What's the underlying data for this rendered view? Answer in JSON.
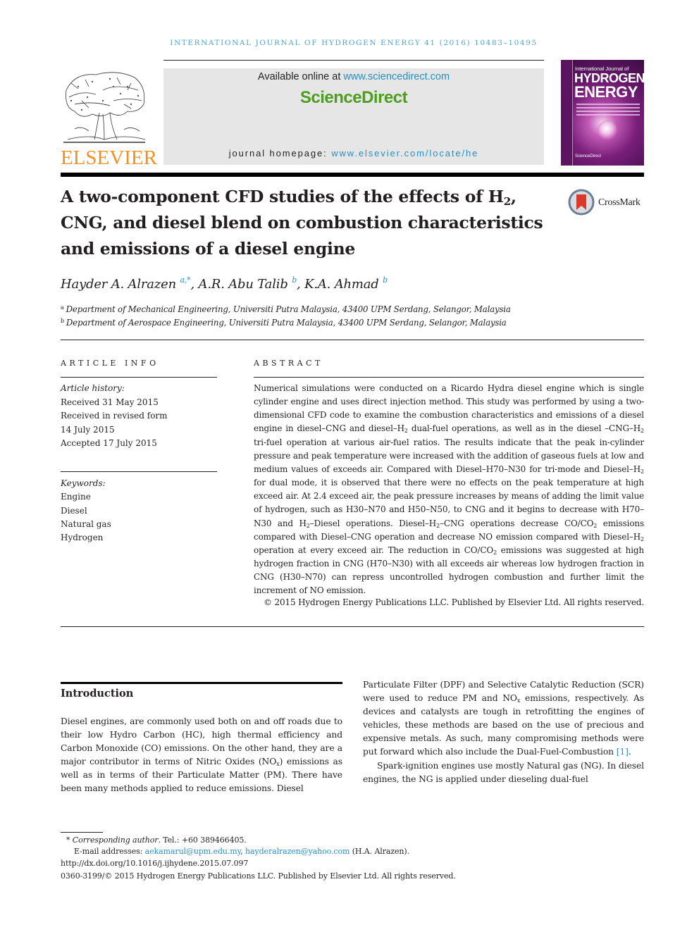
{
  "running_header": "INTERNATIONAL JOURNAL OF HYDROGEN ENERGY 41 (2016) 10483–10495",
  "banner": {
    "publisher_logo": "ELSEVIER",
    "available_online_prefix": "Available online at ",
    "available_online_link": "www.sciencedirect.com",
    "platform_name": "ScienceDirect",
    "homepage_prefix": "journal homepage: ",
    "homepage_link": "www.elsevier.com/locate/he",
    "cover": {
      "line1": "International Journal of",
      "line2": "HYDROGEN",
      "line3": "ENERGY",
      "footer": "ScienceDirect"
    }
  },
  "article": {
    "title_part1": "A two-component CFD studies of the effects of H",
    "title_sub": "2",
    "title_part2": ", CNG, and diesel blend on combustion characteristics and emissions of a diesel engine",
    "crossmark_label": "CrossMark",
    "authors": [
      {
        "name": "Hayder A. Alrazen",
        "marks": "a,*"
      },
      {
        "name": "A.R. Abu Talib",
        "marks": "b"
      },
      {
        "name": "K.A. Ahmad",
        "marks": "b"
      }
    ],
    "affiliations": [
      {
        "mark": "a",
        "text": "Department of Mechanical Engineering, Universiti Putra Malaysia, 43400 UPM Serdang, Selangor, Malaysia"
      },
      {
        "mark": "b",
        "text": "Department of Aerospace Engineering, Universiti Putra Malaysia, 43400 UPM Serdang, Selangor, Malaysia"
      }
    ]
  },
  "article_info": {
    "heading": "ARTICLE INFO",
    "history_label": "Article history:",
    "history": [
      "Received 31 May 2015",
      "Received in revised form",
      "14 July 2015",
      "Accepted 17 July 2015"
    ],
    "keywords_label": "Keywords:",
    "keywords": [
      "Engine",
      "Diesel",
      "Natural gas",
      "Hydrogen"
    ]
  },
  "abstract": {
    "heading": "ABSTRACT",
    "segments": [
      "Numerical simulations were conducted on a Ricardo Hydra diesel engine which is single cylinder engine and uses direct injection method. This study was performed by using a two-dimensional CFD code to examine the combustion characteristics and emissions of a diesel engine in diesel–CNG and diesel–H",
      "2",
      " dual-fuel operations, as well as in the diesel –CNG–H",
      "2",
      " tri-fuel operation at various air-fuel ratios. The results indicate that the peak in-cylinder pressure and peak temperature were increased with the addition of gaseous fuels at low and medium values of exceeds air. Compared with Diesel–H70–N30 for tri-mode and Diesel–H",
      "2",
      " for dual mode, it is observed that there were no effects on the peak temperature at high exceed air. At 2.4 exceed air, the peak pressure increases by means of adding the limit value of hydrogen, such as H30–N70 and H50–N50, to CNG and it begins to decrease with H70–N30 and H",
      "2",
      "–Diesel operations. Diesel–H",
      "2",
      "–CNG operations decrease CO/CO",
      "2",
      " emissions compared with Diesel–CNG operation and decrease NO emission compared with Diesel–H",
      "2",
      " operation at every exceed air. The reduction in CO/CO",
      "2",
      " emissions was suggested at high hydrogen fraction in CNG (H70–N30) with all exceeds air whereas low hydrogen fraction in CNG (H30–N70) can repress uncontrolled hydrogen combustion and further limit the increment of NO emission."
    ],
    "copyright": "© 2015 Hydrogen Energy Publications LLC. Published by Elsevier Ltd. All rights reserved."
  },
  "introduction": {
    "heading": "Introduction",
    "left_col": [
      "Diesel engines, are commonly used both on and off roads due to their low Hydro Carbon (HC), high thermal efficiency and Carbon Monoxide (CO) emissions. On the other hand, they are a major contributor in terms of Nitric Oxides (NO",
      "x",
      ") emissions as well as in terms of their Particulate Matter (PM). There have been many methods applied to reduce emissions. Diesel"
    ],
    "right_col_p1": [
      "Particulate Filter (DPF) and Selective Catalytic Reduction (SCR) were used to reduce PM and NO",
      "x",
      " emissions, respectively. As devices and catalysts are tough in retrofitting the engines of vehicles, these methods are based on the use of precious and expensive metals. As such, many compromising methods were put forward which also include the Dual-Fuel-Combustion ",
      "[1]",
      "."
    ],
    "right_col_p2": "Spark-ignition engines use mostly Natural gas (NG). In diesel engines, the NG is applied under dieseling dual-fuel"
  },
  "footnotes": {
    "corresponding_label": "Corresponding author",
    "corresponding_rest": ". Tel.: +60 389466405.",
    "email_label": "E-mail addresses: ",
    "emails": [
      "aekamarul@upm.edu.my",
      "hayderalrazen@yahoo.com"
    ],
    "email_suffix": " (H.A. Alrazen).",
    "doi": "http://dx.doi.org/10.1016/j.ijhydene.2015.07.097",
    "issn_line": "0360-3199/© 2015 Hydrogen Energy Publications LLC. Published by Elsevier Ltd. All rights reserved."
  },
  "colors": {
    "link": "#2a8ec0",
    "running_header": "#4ea7c9",
    "sciencedirect_green": "#4b9e1f",
    "elsevier_orange": "#f29222",
    "banner_grey": "#e6e6e6"
  }
}
